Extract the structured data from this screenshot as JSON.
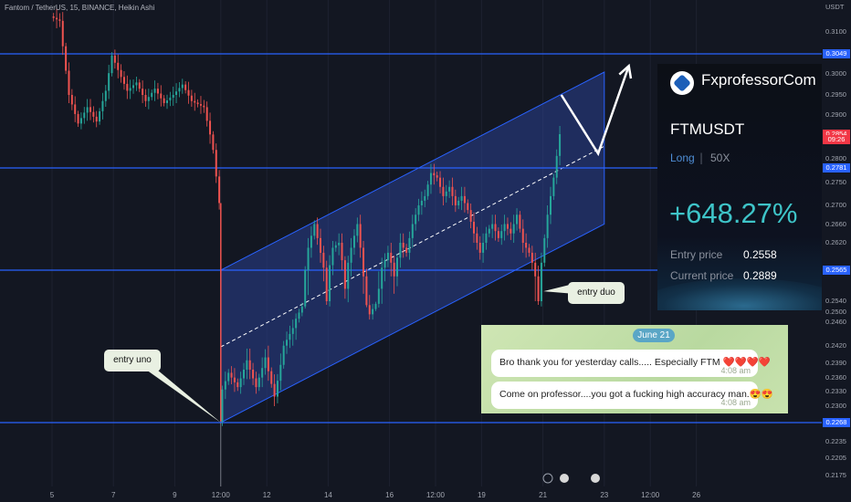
{
  "header": {
    "legend": "Fantom / TetherUS, 15, BINANCE, Heikin Ashi",
    "currency": "USDT"
  },
  "chart_data": {
    "type": "candlestick",
    "ylim": [
      0.2165,
      0.3135
    ],
    "yticks": [
      "0.2175",
      "0.2205",
      "0.2235",
      "0.2268",
      "0.2300",
      "0.2330",
      "0.2360",
      "0.2390",
      "0.2420",
      "0.2460",
      "0.2500",
      "0.2540",
      "0.2565",
      "0.2620",
      "0.2660",
      "0.2700",
      "0.2750",
      "0.2781",
      "0.2800",
      "0.2854",
      "0.2900",
      "0.2950",
      "0.3000",
      "0.3049",
      "0.3100"
    ],
    "xticks": [
      {
        "label": "5",
        "t": 0
      },
      {
        "label": "7",
        "t": 2
      },
      {
        "label": "9",
        "t": 4
      },
      {
        "label": "12:00",
        "t": 5.5
      },
      {
        "label": "12",
        "t": 7
      },
      {
        "label": "14",
        "t": 9
      },
      {
        "label": "16",
        "t": 11
      },
      {
        "label": "12:00",
        "t": 12.5
      },
      {
        "label": "19",
        "t": 14
      },
      {
        "label": "21",
        "t": 16
      },
      {
        "label": "23",
        "t": 18
      },
      {
        "label": "12:00",
        "t": 19.5
      },
      {
        "label": "26",
        "t": 21
      }
    ],
    "horizontal_lines": [
      0.3049,
      0.2781,
      0.2565,
      0.2268
    ],
    "price_labels": [
      {
        "value": "0.3049",
        "price": 0.3049,
        "bg": "#2962ff"
      },
      {
        "value": "0.2854",
        "price": 0.2854,
        "bg": "#f23645"
      },
      {
        "value": "09:26",
        "price": 0.2842,
        "bg": "#f23645"
      },
      {
        "value": "0.2781",
        "price": 0.2781,
        "bg": "#2962ff"
      },
      {
        "value": "0.2565",
        "price": 0.2565,
        "bg": "#2962ff"
      },
      {
        "value": "0.2268",
        "price": 0.2268,
        "bg": "#2962ff"
      }
    ],
    "channel": {
      "start": {
        "t": 5.5,
        "p": 0.2565
      },
      "end": {
        "t": 18.0,
        "p": 0.3005
      },
      "lower_start": 0.2268,
      "lower_end": 0.266
    },
    "midline": {
      "start": {
        "t": 5.5,
        "p": 0.2418
      },
      "end": {
        "t": 18.0,
        "p": 0.2828
      }
    },
    "arrow_path": [
      {
        "t": 16.6,
        "p": 0.295
      },
      {
        "t": 17.8,
        "p": 0.2812
      },
      {
        "t": 18.8,
        "p": 0.302
      }
    ],
    "price_path": [
      [
        0.0,
        0.3135
      ],
      [
        0.3,
        0.3125
      ],
      [
        0.6,
        0.295
      ],
      [
        0.9,
        0.288
      ],
      [
        1.2,
        0.292
      ],
      [
        1.5,
        0.2885
      ],
      [
        1.8,
        0.296
      ],
      [
        2.0,
        0.3045
      ],
      [
        2.2,
        0.301
      ],
      [
        2.5,
        0.296
      ],
      [
        2.8,
        0.298
      ],
      [
        3.1,
        0.2935
      ],
      [
        3.4,
        0.2965
      ],
      [
        3.7,
        0.293
      ],
      [
        4.0,
        0.295
      ],
      [
        4.3,
        0.2975
      ],
      [
        4.6,
        0.2935
      ],
      [
        5.0,
        0.292
      ],
      [
        5.3,
        0.282
      ],
      [
        5.5,
        0.2705
      ],
      [
        5.5,
        0.227
      ],
      [
        5.6,
        0.2335
      ],
      [
        5.8,
        0.237
      ],
      [
        6.1,
        0.234
      ],
      [
        6.4,
        0.2395
      ],
      [
        6.7,
        0.234
      ],
      [
        7.0,
        0.24
      ],
      [
        7.3,
        0.232
      ],
      [
        7.6,
        0.242
      ],
      [
        7.9,
        0.245
      ],
      [
        8.2,
        0.252
      ],
      [
        8.4,
        0.261
      ],
      [
        8.6,
        0.266
      ],
      [
        8.8,
        0.26
      ],
      [
        9.0,
        0.254
      ],
      [
        9.2,
        0.261
      ],
      [
        9.4,
        0.262
      ],
      [
        9.6,
        0.255
      ],
      [
        9.8,
        0.261
      ],
      [
        10.0,
        0.266
      ],
      [
        10.2,
        0.256
      ],
      [
        10.4,
        0.249
      ],
      [
        10.6,
        0.253
      ],
      [
        10.8,
        0.257
      ],
      [
        11.0,
        0.26
      ],
      [
        11.2,
        0.256
      ],
      [
        11.4,
        0.262
      ],
      [
        11.6,
        0.26
      ],
      [
        11.8,
        0.266
      ],
      [
        12.0,
        0.27
      ],
      [
        12.2,
        0.272
      ],
      [
        12.4,
        0.277
      ],
      [
        12.6,
        0.276
      ],
      [
        12.8,
        0.272
      ],
      [
        13.0,
        0.274
      ],
      [
        13.2,
        0.27
      ],
      [
        13.4,
        0.272
      ],
      [
        13.6,
        0.269
      ],
      [
        13.8,
        0.264
      ],
      [
        14.0,
        0.26
      ],
      [
        14.2,
        0.264
      ],
      [
        14.4,
        0.266
      ],
      [
        14.6,
        0.263
      ],
      [
        14.8,
        0.266
      ],
      [
        15.0,
        0.264
      ],
      [
        15.2,
        0.268
      ],
      [
        15.4,
        0.262
      ],
      [
        15.6,
        0.26
      ],
      [
        15.8,
        0.256
      ],
      [
        15.9,
        0.254
      ],
      [
        16.0,
        0.258
      ],
      [
        16.2,
        0.268
      ],
      [
        16.4,
        0.276
      ],
      [
        16.6,
        0.2854
      ]
    ]
  },
  "card": {
    "brand": "FxprofessorCom",
    "symbol": "FTMUSDT",
    "side": "Long",
    "separator": "|",
    "leverage": "50X",
    "percent": "+648.27%",
    "entry_label": "Entry price",
    "entry_value": "0.2558",
    "current_label": "Current price",
    "current_value": "0.2889"
  },
  "chat": {
    "date": "June 21",
    "messages": [
      {
        "text": "Bro thank you for yesterday calls..... Especially FTM ❤️❤️❤️❤️",
        "time": "4:08 am"
      },
      {
        "text": "Come on professor....you got a fucking high accuracy man.😍😍",
        "time": "4:08 am"
      }
    ]
  },
  "callouts": {
    "entry_uno": "entry uno",
    "entry_duo": "entry duo"
  },
  "colors": {
    "background": "#131722",
    "hline": "#2962ff",
    "up": "#26a69a",
    "down": "#ef5350",
    "channel_fill": "#2a3f8f",
    "card_accent": "#3ec4c8",
    "price_badge": "#f23645"
  }
}
